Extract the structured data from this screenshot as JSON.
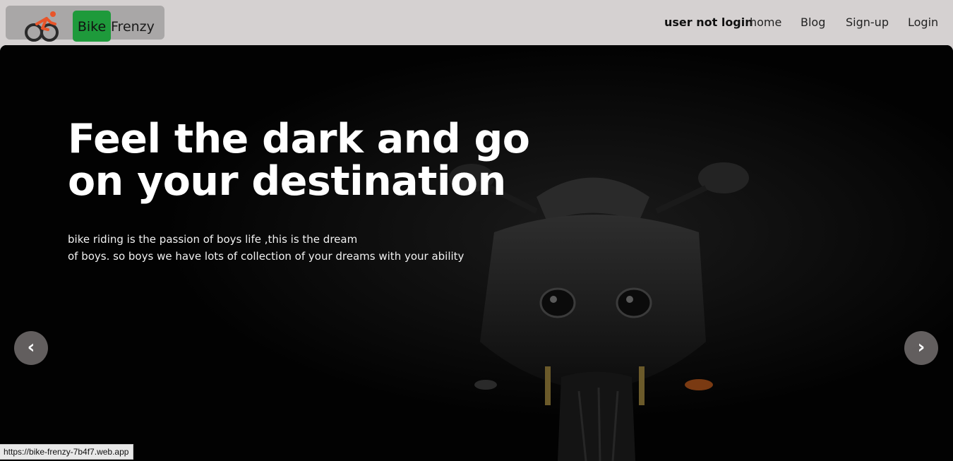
{
  "navbar": {
    "brand_part1": "Bike",
    "brand_part2": "Frenzy",
    "user_status": "user not login",
    "links": [
      "home",
      "Blog",
      "Sign-up",
      "Login"
    ],
    "brand_accent_color": "#1e9a3b",
    "logo_icon": "cyclist-logo-icon"
  },
  "hero": {
    "title": "Feel the dark and go on your destination",
    "description_line1": "bike riding is the passion of boys life ,this is the dream",
    "description_line2": "of boys. so boys we have lots of collection of your dreams with your ability",
    "prev_label": "‹",
    "next_label": "›",
    "image_subject": "black-motorcycle-front-view"
  },
  "status_bar": {
    "url": "https://bike-frenzy-7b4f7.web.app"
  }
}
